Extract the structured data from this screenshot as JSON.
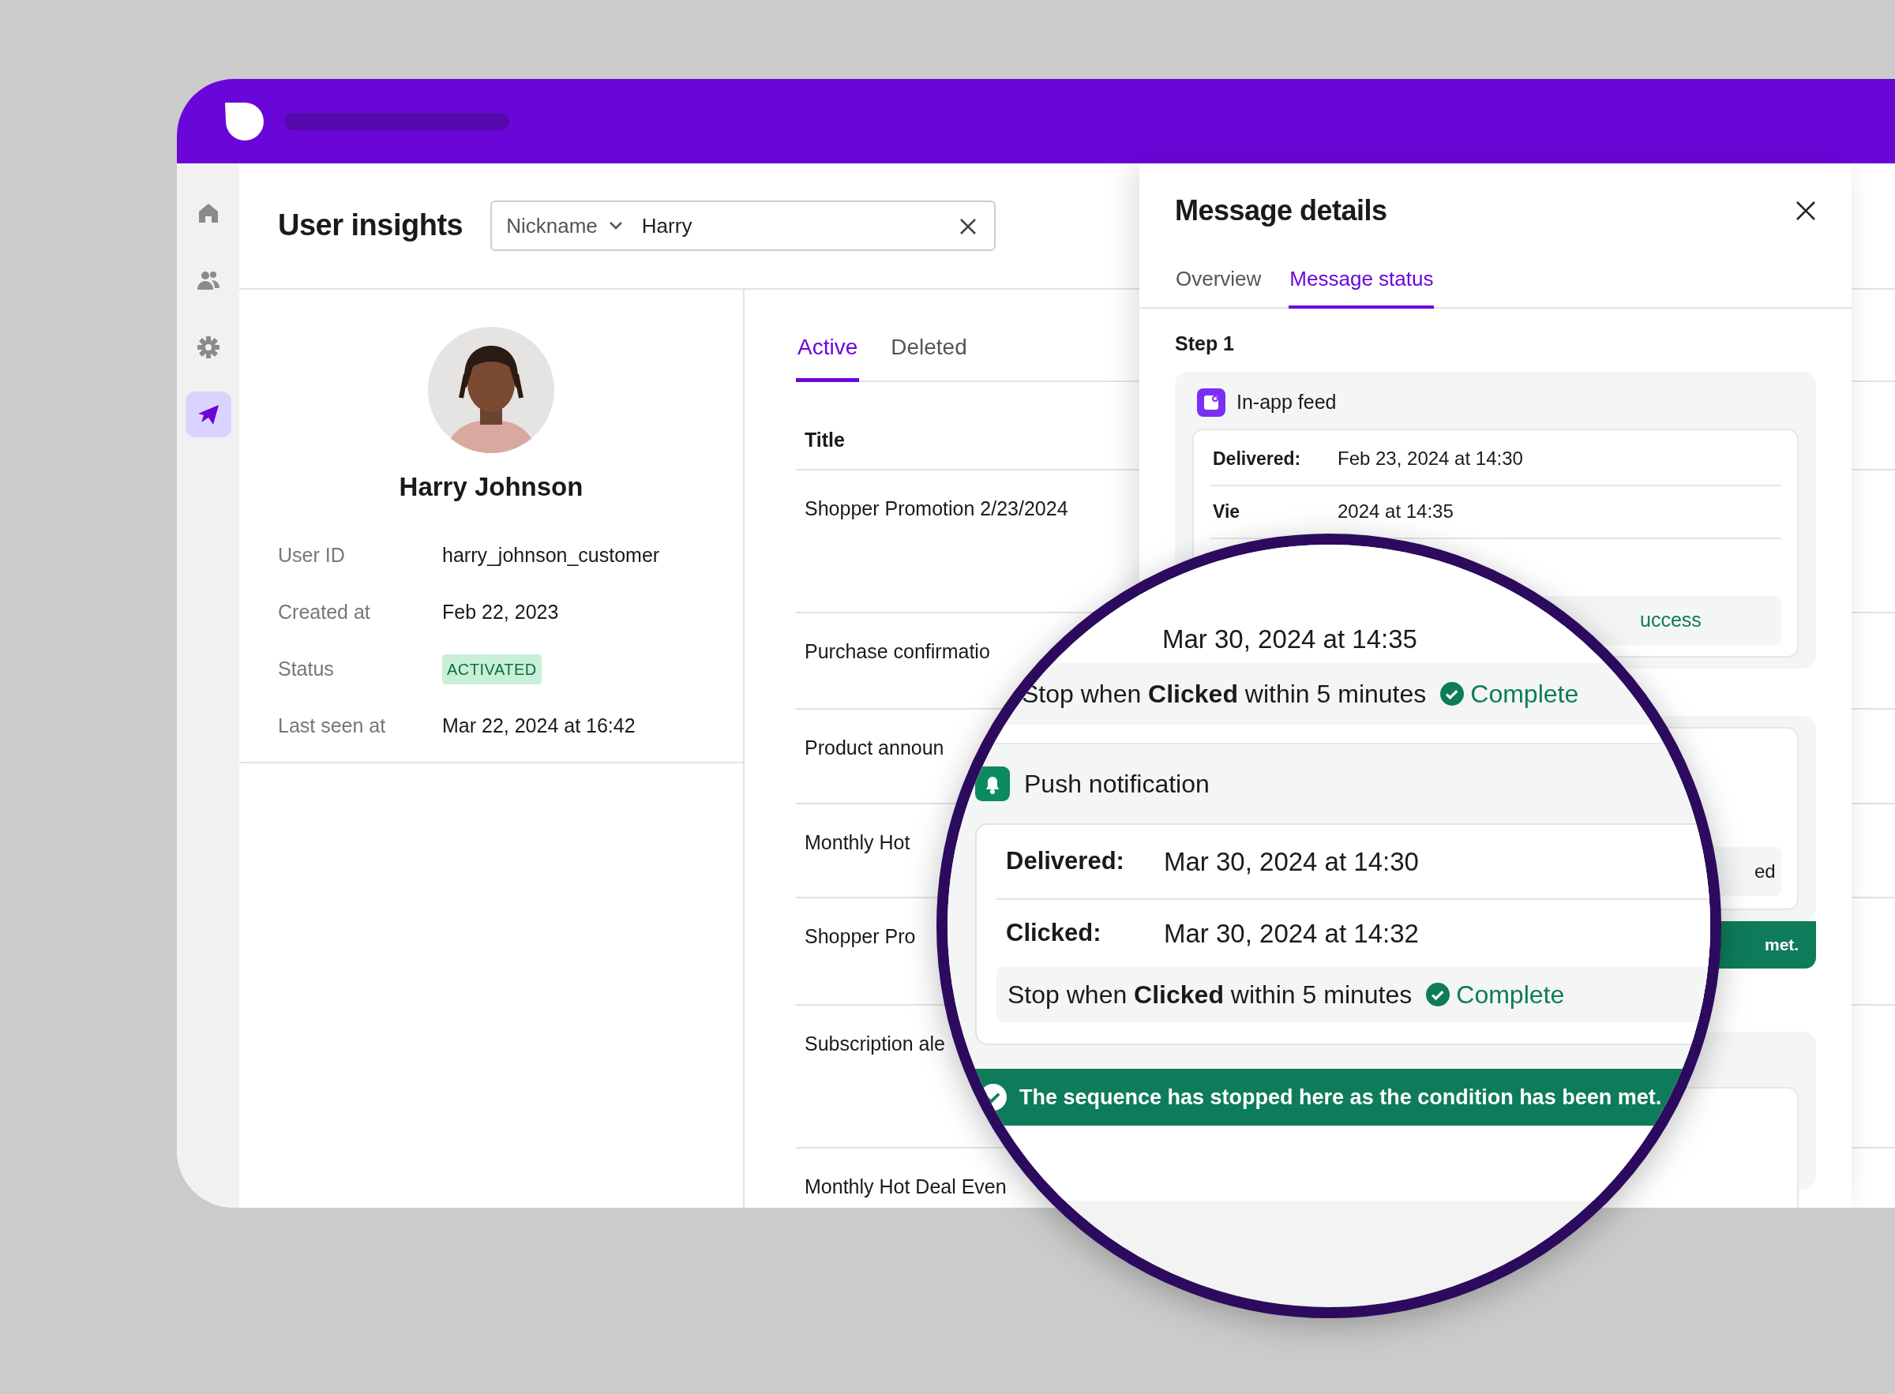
{
  "sidebar": {
    "items": [
      {
        "kind": "home",
        "selected": false
      },
      {
        "kind": "users",
        "selected": false
      },
      {
        "kind": "settings",
        "selected": false
      },
      {
        "kind": "send",
        "selected": true
      }
    ]
  },
  "page_title": "User insights",
  "search": {
    "filter": "Nickname",
    "value": "Harry"
  },
  "profile": {
    "name": "Harry Johnson",
    "fields": [
      {
        "label": "User ID",
        "value": "harry_johnson_customer",
        "kind": "text"
      },
      {
        "label": "Created at",
        "value": "Feb 22, 2023",
        "kind": "text"
      },
      {
        "label": "Status",
        "value": "ACTIVATED",
        "kind": "badge"
      },
      {
        "label": "Last seen at",
        "value": "Mar 22, 2024 at 16:42",
        "kind": "text"
      }
    ]
  },
  "messages": {
    "tabs": [
      {
        "label": "Active",
        "selected": true
      },
      {
        "label": "Deleted",
        "selected": false
      }
    ],
    "columns": [
      "Title"
    ],
    "rows": [
      "Shopper Promotion 2/23/2024",
      "Purchase confirmatio",
      "Product announ",
      "Monthly Hot",
      "Shopper Pro",
      "Subscription ale",
      "Monthly Hot Deal Even"
    ]
  },
  "details": {
    "title": "Message details",
    "tabs": [
      {
        "label": "Overview",
        "selected": false
      },
      {
        "label": "Message status",
        "selected": true
      }
    ],
    "step": "Step 1",
    "channel": "In-app feed",
    "events": [
      {
        "label": "Delivered:",
        "value": "Feb 23, 2024 at 14:30"
      },
      {
        "label": "Vie",
        "value": "2024 at 14:35"
      }
    ],
    "condition_status": "uccess",
    "second_condition_status": "ed",
    "banner": "met."
  },
  "magnifier": {
    "viewed_value": "Mar 30, 2024 at 14:35",
    "first_condition": {
      "text": "Stop when **Clicked** within 5 minutes",
      "status": "Complete"
    },
    "channel": "Push notification",
    "events": [
      {
        "label": "Delivered:",
        "value": "Mar 30, 2024 at 14:30"
      },
      {
        "label": "Clicked:",
        "value": "Mar 30, 2024 at 14:32"
      }
    ],
    "condition": {
      "text": "Stop when **Clicked** within 5 minutes",
      "status": "Complete"
    },
    "banner": "The sequence has stopped here as the condition has been met."
  }
}
